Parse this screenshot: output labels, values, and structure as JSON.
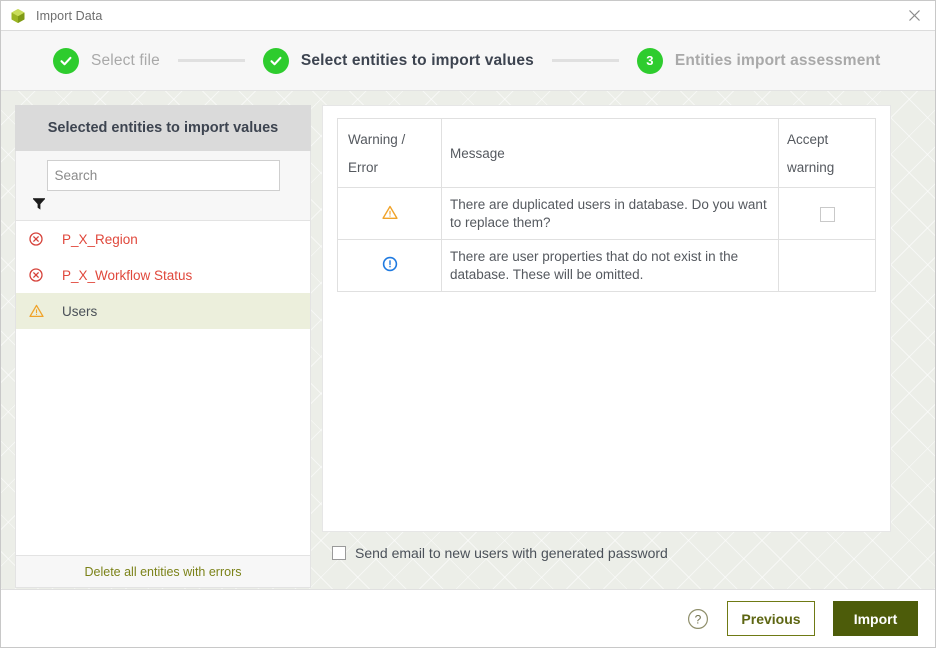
{
  "window": {
    "title": "Import Data",
    "app_icon": "cube-icon",
    "close_icon": "close-icon"
  },
  "stepper": {
    "steps": [
      {
        "badge": "✓",
        "label": "Select file",
        "state": "done",
        "icon": "check-circle-icon"
      },
      {
        "badge": "✓",
        "label": "Select entities to import values",
        "state": "active",
        "icon": "check-circle-icon"
      },
      {
        "badge": "3",
        "label": "Entities import assessment",
        "state": "future",
        "icon": "number-circle-icon"
      }
    ]
  },
  "left_panel": {
    "title": "Selected entities to import values",
    "search": {
      "placeholder": "Search",
      "value": ""
    },
    "filter_icon": "filter-funnel-icon",
    "entities": [
      {
        "label": "P_X_Region",
        "status": "error",
        "icon": "error-circle-icon"
      },
      {
        "label": "P_X_Workflow Status",
        "status": "error",
        "icon": "error-circle-icon"
      },
      {
        "label": "Users",
        "status": "warning",
        "icon": "warning-triangle-icon",
        "selected": true
      }
    ],
    "footer_action": "Delete all entities with errors"
  },
  "right_panel": {
    "table": {
      "columns": [
        {
          "line1": "Warning /",
          "line2": "Error"
        },
        {
          "line1": "Message",
          "line2": ""
        },
        {
          "line1": "Accept",
          "line2": "warning"
        }
      ],
      "rows": [
        {
          "severity": "warning",
          "icon": "warning-triangle-icon",
          "message": "There are duplicated users in database. Do you want to replace them?",
          "accept_checkbox": true,
          "accept_checked": false
        },
        {
          "severity": "info",
          "icon": "info-circle-icon",
          "message": "There are user properties that do not exist in the database. These will be omitted.",
          "accept_checkbox": false,
          "accept_checked": false
        }
      ]
    },
    "send_email": {
      "label": "Send email to new users with generated password",
      "checked": false
    }
  },
  "footer": {
    "help_icon": "help-question-icon",
    "previous_label": "Previous",
    "import_label": "Import"
  },
  "colors": {
    "step_green": "#2ecc2e",
    "error_red": "#e0483c",
    "warning_orange": "#f0a32a",
    "info_blue": "#1f7ae0",
    "accent_olive": "#4d5c0a",
    "selected_row": "#ecefdc"
  }
}
